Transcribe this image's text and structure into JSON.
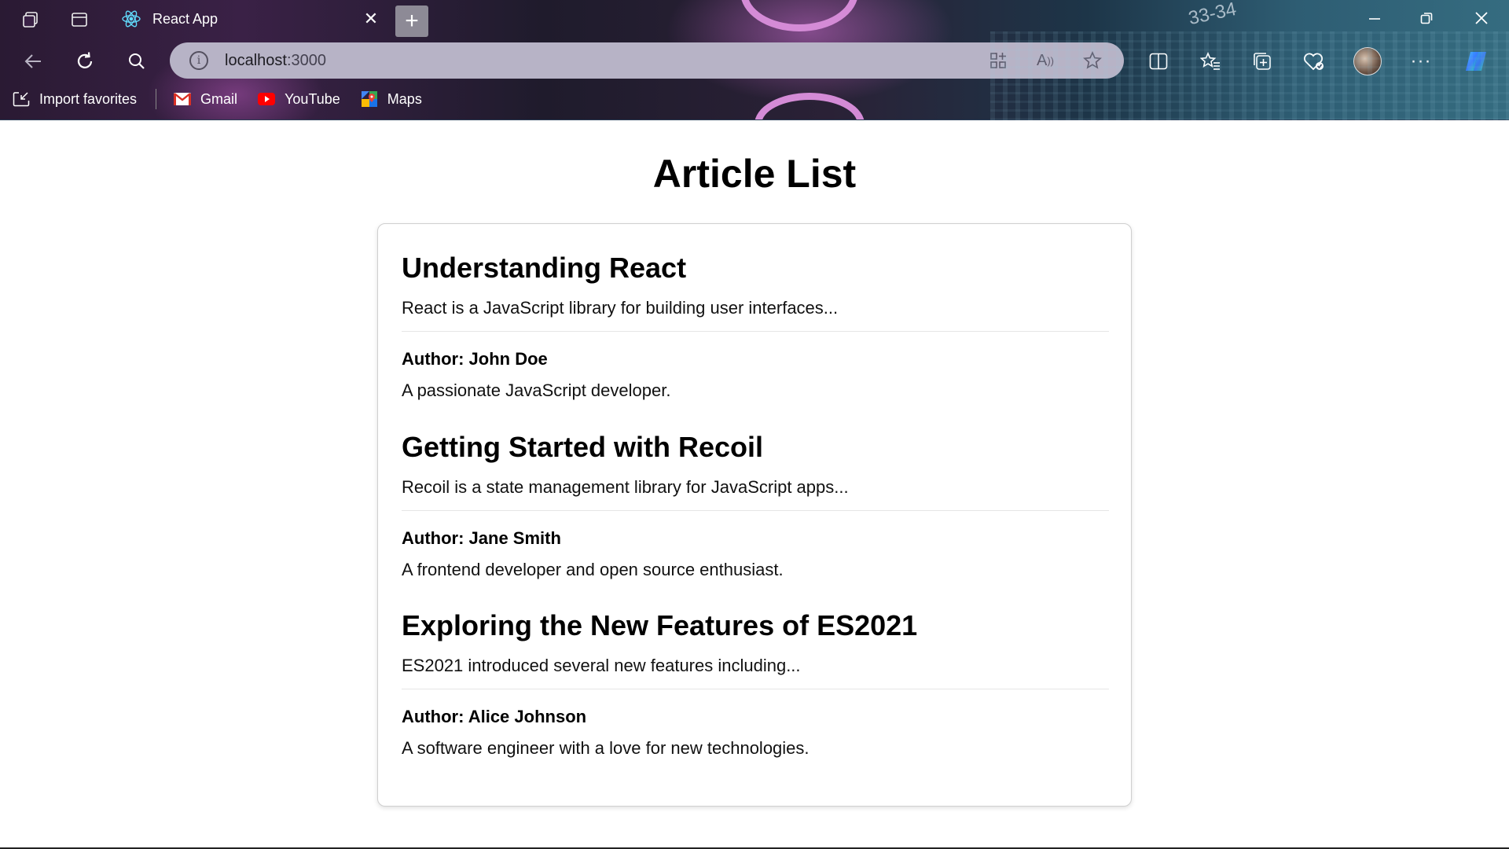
{
  "browser": {
    "tab": {
      "title": "React App"
    },
    "address": {
      "url_host": "localhost",
      "url_port": ":3000"
    },
    "bookmarks": [
      {
        "label": "Import favorites",
        "icon": "import-icon"
      },
      {
        "label": "Gmail",
        "icon": "gmail-icon",
        "color": "#d93025"
      },
      {
        "label": "YouTube",
        "icon": "youtube-icon",
        "color": "#ff0000"
      },
      {
        "label": "Maps",
        "icon": "maps-icon"
      }
    ],
    "wallpaper_text": "33-34"
  },
  "page": {
    "title": "Article List",
    "articles": [
      {
        "title": "Understanding React",
        "excerpt": "React is a JavaScript library for building user interfaces...",
        "author": "Author: John Doe",
        "bio": "A passionate JavaScript developer."
      },
      {
        "title": "Getting Started with Recoil",
        "excerpt": "Recoil is a state management library for JavaScript apps...",
        "author": "Author: Jane Smith",
        "bio": "A frontend developer and open source enthusiast."
      },
      {
        "title": "Exploring the New Features of ES2021",
        "excerpt": "ES2021 introduced several new features including...",
        "author": "Author: Alice Johnson",
        "bio": "A software engineer with a love for new technologies."
      }
    ]
  }
}
